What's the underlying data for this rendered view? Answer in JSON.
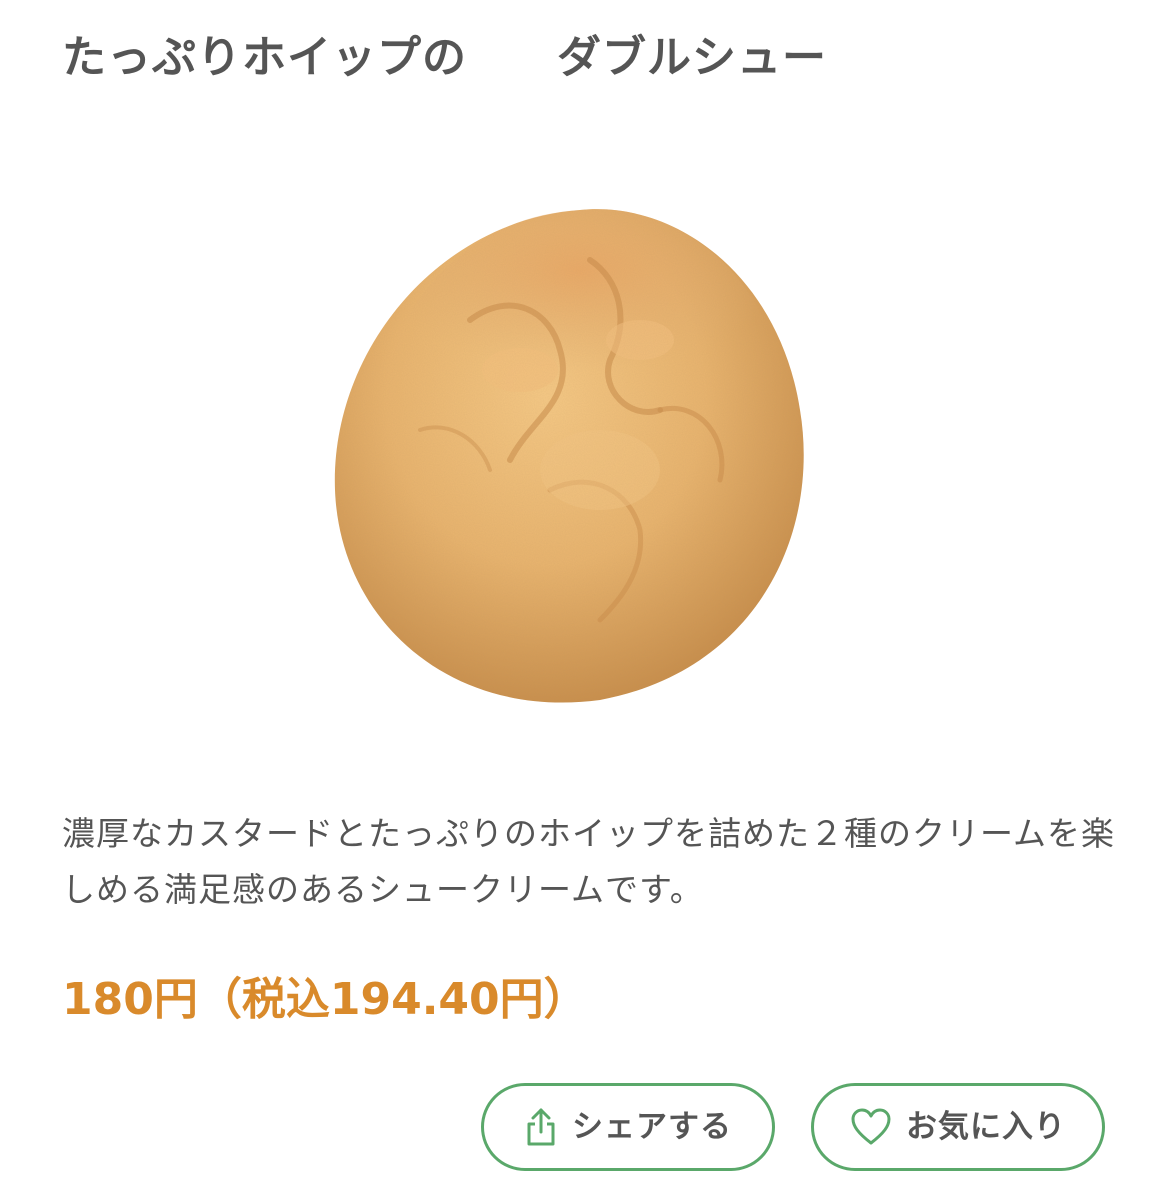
{
  "product": {
    "title": "たっぷりホイップの　　ダブルシュー",
    "image_alt": "cream puff",
    "description": "濃厚なカスタードとたっぷりのホイップを詰めた２種のクリームを楽しめる満足感のあるシュークリームです。",
    "price": "180円（税込194.40円）"
  },
  "actions": {
    "share_label": "シェアする",
    "share_icon": "share-icon",
    "favorite_label": "お気に入り",
    "favorite_icon": "heart-icon"
  },
  "colors": {
    "price": "#d98a2b",
    "button_border": "#5aa86a",
    "text": "#555555"
  }
}
